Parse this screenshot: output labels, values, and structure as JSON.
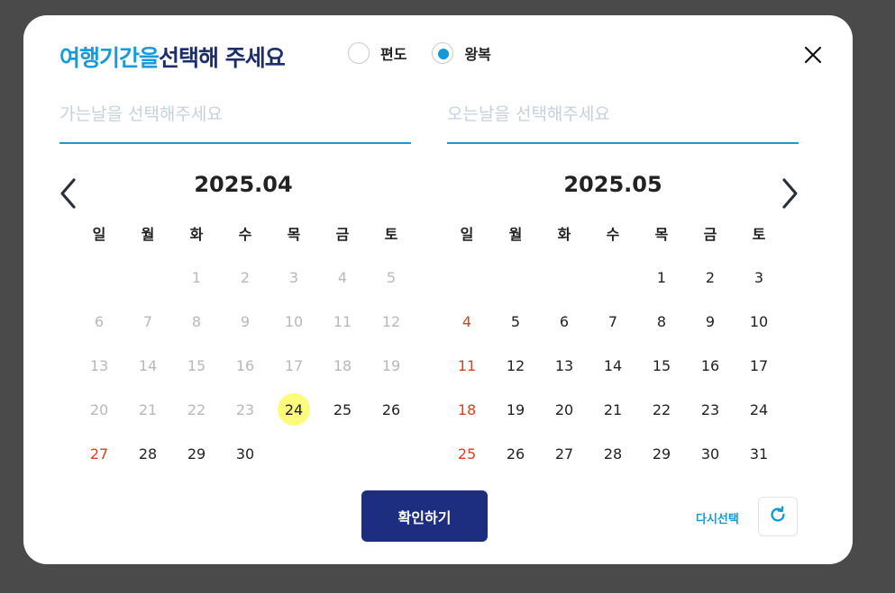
{
  "header": {
    "title_highlight": "여행기간을",
    "title_rest": "선택해 주세요",
    "trip_type": {
      "options": [
        {
          "label": "편도",
          "checked": false
        },
        {
          "label": "왕복",
          "checked": true
        }
      ]
    },
    "close_icon": "close-icon"
  },
  "fields": {
    "departure_placeholder": "가는날을 선택해주세요",
    "return_placeholder": "오는날을 선택해주세요"
  },
  "colors": {
    "accent": "#139ad6",
    "navy": "#1d2e80",
    "sunday": "#d64220",
    "today": "#fdfb7c"
  },
  "weekdays": [
    "일",
    "월",
    "화",
    "수",
    "목",
    "금",
    "토"
  ],
  "calendars": [
    {
      "title": "2025.04",
      "first_weekday": 2,
      "days_in_month": 30,
      "past_through": 23,
      "today": 24
    },
    {
      "title": "2025.05",
      "first_weekday": 4,
      "days_in_month": 31,
      "past_through": 0,
      "today": null
    }
  ],
  "footer": {
    "confirm_label": "확인하기",
    "reset_label": "다시선택",
    "reset_icon": "refresh-icon"
  }
}
